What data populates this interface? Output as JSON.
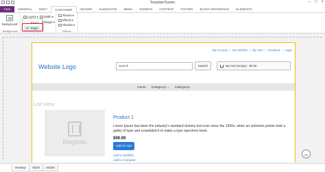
{
  "titlebar": {
    "title": "TemplateToaster"
  },
  "ribbon_tabs": [
    {
      "label": "FILE"
    },
    {
      "label": "GENERAL"
    },
    {
      "label": "BODY"
    },
    {
      "label": "CONTAINER"
    },
    {
      "label": "HEADER"
    },
    {
      "label": "SLIDESHOW"
    },
    {
      "label": "MENU"
    },
    {
      "label": "SIDEBAR"
    },
    {
      "label": "CONTENT"
    },
    {
      "label": "FOOTER"
    },
    {
      "label": "BLOCK REFERENCE"
    },
    {
      "label": "ELEMENTS"
    }
  ],
  "active_tab": "CONTAINER",
  "ribbon": {
    "background_label": "Background",
    "background_group": "Background",
    "layout_label": "Layout",
    "width_label": "Width",
    "margin_label": "Margin",
    "texture_label": "Texture",
    "effects_label": "Effects",
    "shadow_label": "Shadow",
    "effects_group": "Effects",
    "layout_options": [
      {
        "label": "Fixed",
        "checked": false
      },
      {
        "label": "Fluid",
        "checked": true
      }
    ]
  },
  "page": {
    "top_links": [
      "My Account",
      "My Wishlist",
      "My Cart",
      "Checkout",
      "Login"
    ],
    "logo": "Website Logo",
    "search_placeholder": "Search",
    "search_button": "Search",
    "cart_label": "My Cart (empty) - $0.00",
    "nav": {
      "home": "Home",
      "cat1": "Category1",
      "cat2": "Category2"
    },
    "list_view": "List View",
    "product": {
      "image_text": "Magento",
      "title": "Product 1",
      "description": "Lorem Ipsum has been the industry's standard dummy text ever since the 1500s, when an unknown printer took a galley of type and scrambled it to make a type specimen book.",
      "price": "$99.99",
      "add_to_cart": "Add to Cart",
      "wishlist": "Add to Wishlist",
      "compare": "Add to Compare"
    }
  },
  "device_tabs": [
    {
      "label": "Desktop",
      "active": true
    },
    {
      "label": "Tablet",
      "active": false
    },
    {
      "label": "Mobile",
      "active": false
    }
  ],
  "colors": {
    "file_tab": "#6b2f7a",
    "link": "#1f6fbf",
    "highlight_box": "#e0191e",
    "page_border": "#e8c300",
    "button": "#2b7ad9"
  }
}
